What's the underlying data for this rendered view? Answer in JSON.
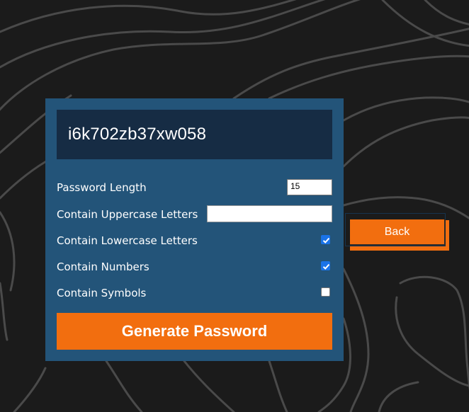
{
  "generator": {
    "password": "i6k702zb37xw058",
    "options": [
      {
        "label": "Password Length",
        "value": "15"
      },
      {
        "label": "Contain Uppercase Letters",
        "value": ""
      },
      {
        "label": "Contain Lowercase Letters",
        "checked": true
      },
      {
        "label": "Contain Numbers",
        "checked": true
      },
      {
        "label": "Contain Symbols",
        "checked": false
      }
    ],
    "generate_label": "Generate Password"
  },
  "back_label": "Back",
  "colors": {
    "background": "#1b1b1b",
    "card": "#235479",
    "result_box": "#162c44",
    "accent": "#f26e0f"
  }
}
